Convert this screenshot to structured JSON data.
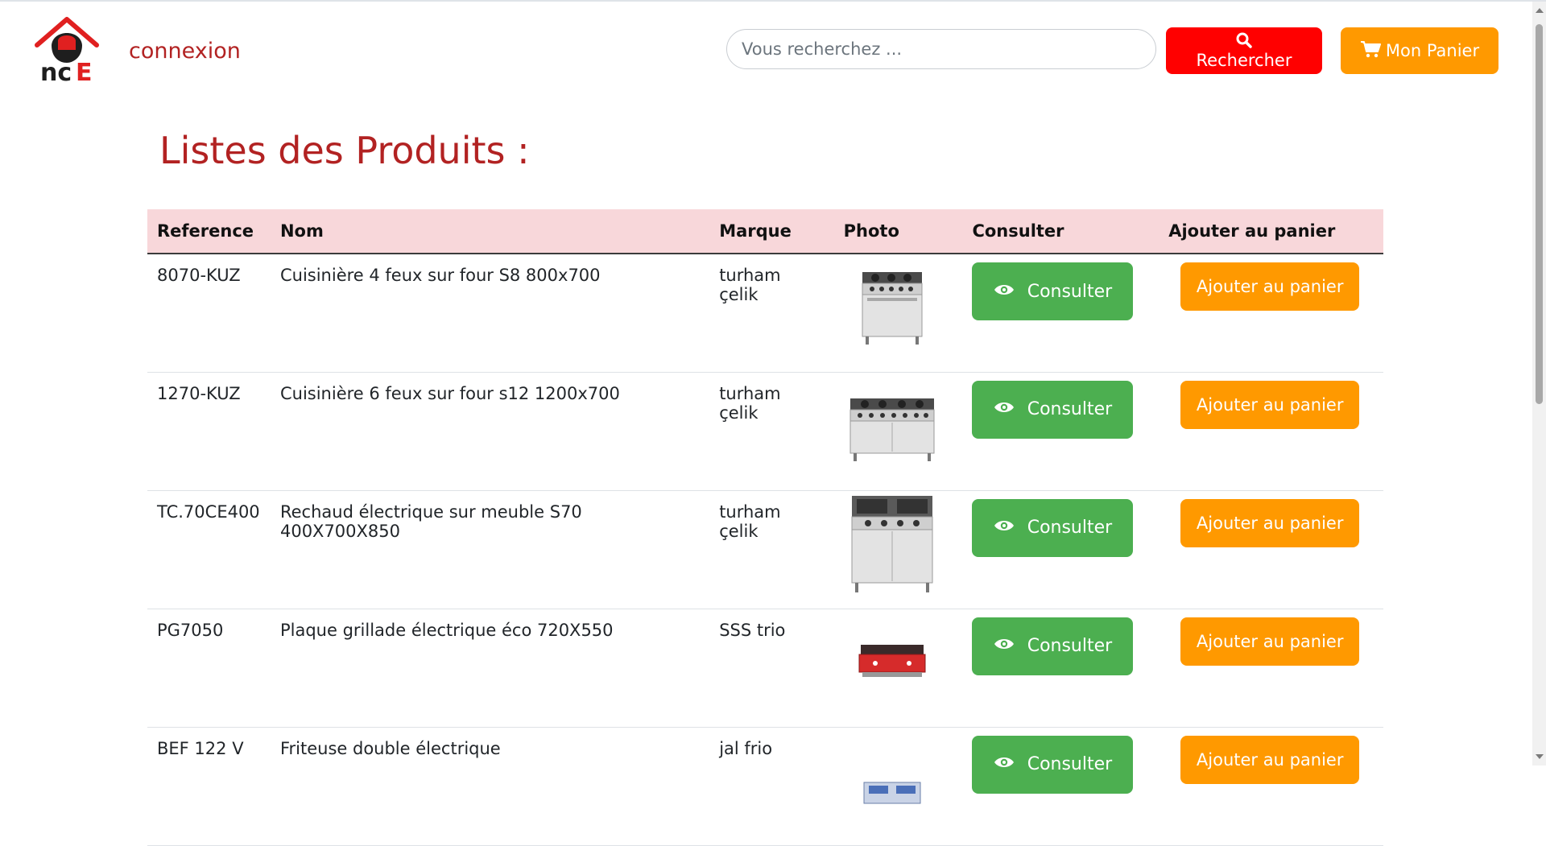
{
  "header": {
    "logo_text": "nce",
    "login_link": "connexion",
    "search_placeholder": "Vous recherchez ...",
    "search_button": "Rechercher",
    "cart_button": "Mon Panier"
  },
  "page": {
    "title": "Listes des Produits :"
  },
  "table": {
    "columns": [
      "Reference",
      "Nom",
      "Marque",
      "Photo",
      "Consulter",
      "Ajouter au panier"
    ],
    "rows": [
      {
        "reference": "8070-KUZ",
        "nom": "Cuisinière 4 feux sur four S8 800x700",
        "marque": "turham çelik",
        "photo": "four-burner-range-image",
        "consult": "Consulter",
        "add": "Ajouter au panier"
      },
      {
        "reference": "1270-KUZ",
        "nom": "Cuisinière 6 feux sur four s12 1200x700",
        "marque": "turham çelik",
        "photo": "six-burner-range-image",
        "consult": "Consulter",
        "add": "Ajouter au panier"
      },
      {
        "reference": "TC.70CE400",
        "nom": "Rechaud électrique sur meuble S70 400X700X850",
        "marque": "turham çelik",
        "photo": "electric-stove-cabinet-image",
        "consult": "Consulter",
        "add": "Ajouter au panier"
      },
      {
        "reference": "PG7050",
        "nom": "Plaque grillade électrique éco 720X550",
        "marque": "SSS trio",
        "photo": "electric-griddle-image",
        "consult": "Consulter",
        "add": "Ajouter au panier"
      },
      {
        "reference": "BEF 122 V",
        "nom": "Friteuse double électrique",
        "marque": "jal frio",
        "photo": "double-fryer-image",
        "consult": "Consulter",
        "add": "Ajouter au panier"
      }
    ]
  },
  "colors": {
    "brand_red": "#b22222",
    "search_button": "#ff0000",
    "cart_button": "#ff9900",
    "consult_button": "#4caf50",
    "table_header_bg": "#f8d7da"
  },
  "icons": {
    "search": "search-icon",
    "cart": "cart-icon",
    "consult": "eye-icon"
  }
}
